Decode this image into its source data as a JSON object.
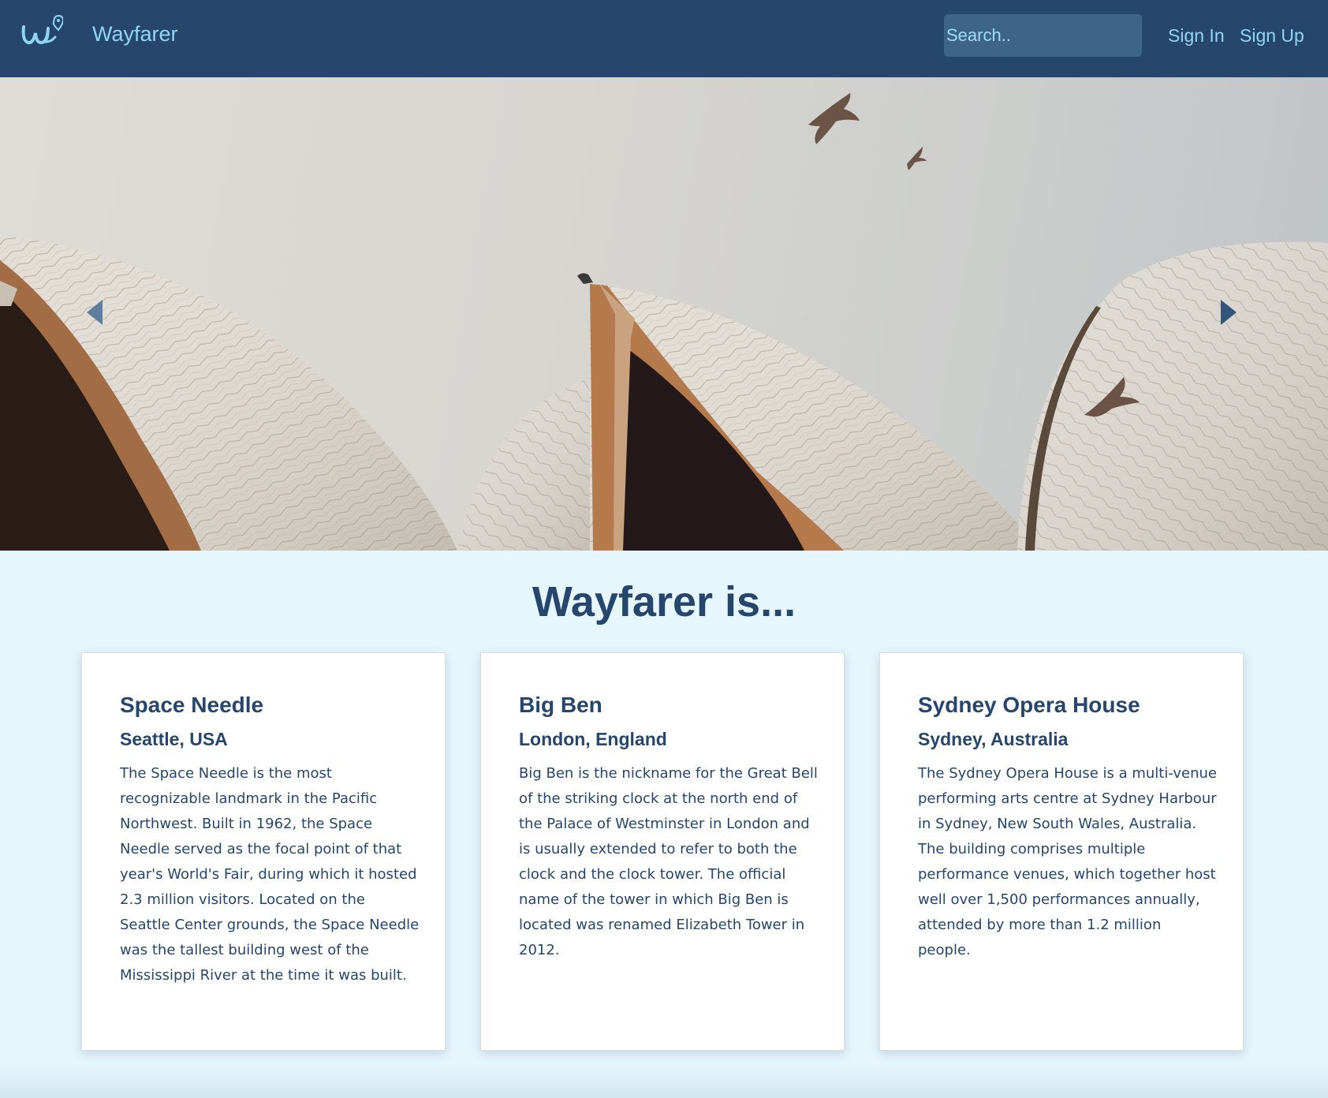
{
  "header": {
    "logo_icon": "wayfarer-logo-icon",
    "brand": "Wayfarer",
    "search": {
      "placeholder": "Search..",
      "value": ""
    },
    "sign_in": "Sign In",
    "sign_up": "Sign Up"
  },
  "hero": {
    "image": "sydney-opera-house-photo",
    "prev_icon": "carousel-prev-arrow-icon",
    "next_icon": "carousel-next-arrow-icon"
  },
  "about": {
    "title": "Wayfarer is...",
    "cards": [
      {
        "title": "Space Needle",
        "subtitle": "Seattle, USA",
        "text": "The Space Needle is the most recognizable landmark in the Pacific Northwest. Built in 1962, the Space Needle served as the focal point of that year's World's Fair, during which it hosted 2.3 million visitors. Located on the Seattle Center grounds, the Space Needle was the tallest building west of the Mississippi River at the time it was built."
      },
      {
        "title": "Big Ben",
        "subtitle": "London, England",
        "text": "Big Ben is the nickname for the Great Bell of the striking clock at the north end of the Palace of Westminster in London and is usually extended to refer to both the clock and the clock tower. The official name of the tower in which Big Ben is located was renamed Elizabeth Tower in 2012."
      },
      {
        "title": "Sydney Opera House",
        "subtitle": "Sydney, Australia",
        "text": "The Sydney Opera House is a multi-venue performing arts centre at Sydney Harbour in Sydney, New South Wales, Australia. The building comprises multiple performance venues, which together host well over 1,500 performances annually, attended by more than 1.2 million people."
      }
    ]
  },
  "colors": {
    "navbar": "#26466d",
    "brand_text": "#8fd6f5",
    "page_background": "#e6f6fd",
    "heading": "#26466d"
  }
}
